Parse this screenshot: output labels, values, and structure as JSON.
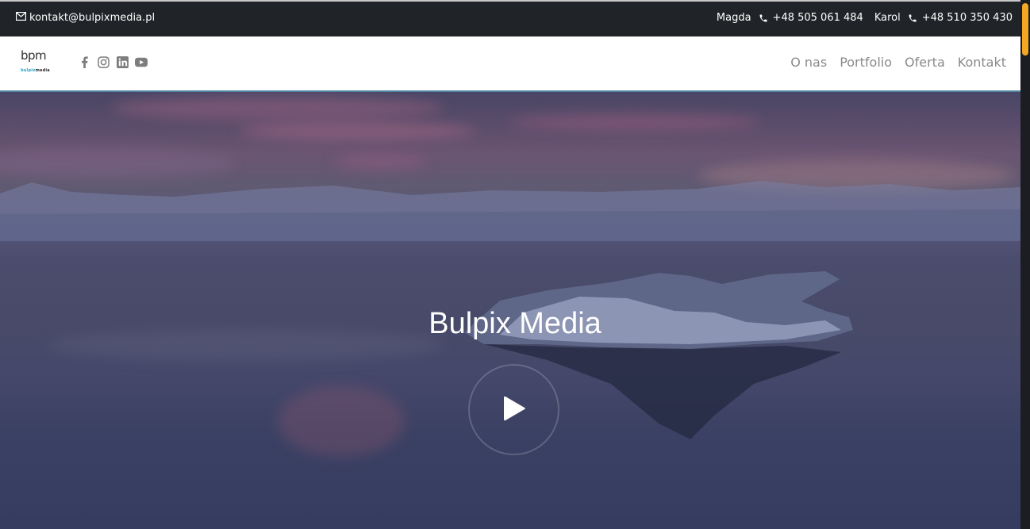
{
  "topbar": {
    "email": "kontakt@bulpixmedia.pl",
    "contacts": [
      {
        "name": "Magda",
        "phone": "+48 505 061 484"
      },
      {
        "name": "Karol",
        "phone": "+48 510 350 430"
      }
    ]
  },
  "logo": {
    "mark": "bpm",
    "word_accent": "bulpix",
    "word_rest": "media"
  },
  "social": [
    "facebook-icon",
    "instagram-icon",
    "linkedin-icon",
    "youtube-icon"
  ],
  "nav": {
    "items": [
      {
        "label": "O nas"
      },
      {
        "label": "Portfolio"
      },
      {
        "label": "Oferta"
      },
      {
        "label": "Kontakt"
      }
    ]
  },
  "hero": {
    "title": "Bulpix Media"
  },
  "colors": {
    "accent": "#f5a623",
    "topbar": "#202327",
    "nav_text": "#8a8a8a",
    "logo_accent": "#2aa3c9"
  }
}
